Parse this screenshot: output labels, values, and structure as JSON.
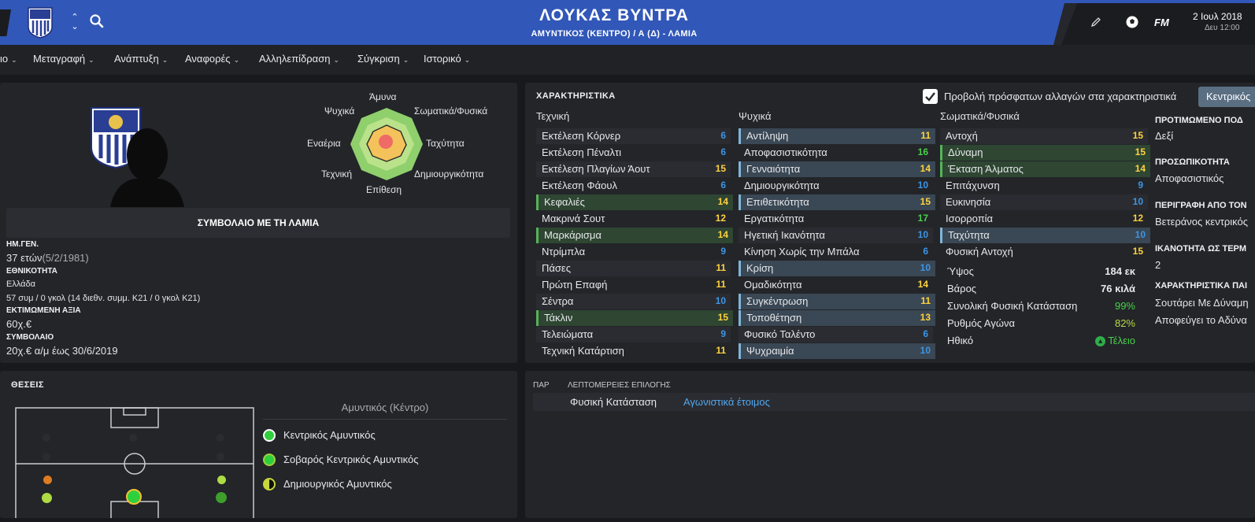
{
  "header": {
    "player_name": "ΛΟΥΚΑΣ ΒΥΝΤΡΑ",
    "subtitle": "ΑΜΥΝΤΙΚΟΣ (ΚΕΝΤΡΟ) / Α (Δ) - ΛΑΜΙΑ",
    "fm_label": "FM",
    "date": "2 Ιουλ 2018",
    "day_time": "Δευ 12:00",
    "icons": [
      "club-badge",
      "nav-up-down",
      "search-icon",
      "pencil-icon",
      "football-icon"
    ]
  },
  "menu": {
    "items": [
      "ιο",
      "Μεταγραφή",
      "Ανάπτυξη",
      "Αναφορές",
      "Αλληλεπίδραση",
      "Σύγκριση",
      "Ιστορικό"
    ]
  },
  "profile": {
    "contract_title": "ΣΥΜΒΟΛΑΙΟ ΜΕ ΤΗ ΛΑΜΙΑ",
    "dob_label": "ΗΜ.ΓΕΝ.",
    "age": "37 ετών",
    "dob": "(5/2/1981)",
    "nationality_label": "ΕΘΝΙΚΟΤΗΤΑ",
    "nationality": "Ελλάδα",
    "caps": "57 συμ / 0 γκολ (14 διεθν. συμμ. Κ21 / 0 γκολ Κ21)",
    "value_label": "ΕΚΤΙΜΩΜΕΝΗ ΑΞΙΑ",
    "value": "60χ.€",
    "contract_label": "ΣΥΜΒΟΛΑΙΟ",
    "contract": "20χ.€ α/μ έως 30/6/2019",
    "radar": {
      "defence": "Άμυνα",
      "physical": "Σωματικά/Φυσικά",
      "speed": "Ταχύτητα",
      "creativity": "Δημιουργικότητα",
      "attack": "Επίθεση",
      "technical": "Τεχνική",
      "aerial": "Εναέρια",
      "mental": "Ψυχικά"
    }
  },
  "attributes": {
    "title": "ΧΑΡΑΚΤΗΡΙΣΤΙΚΑ",
    "checkbox_label": "Προβολή πρόσφατων αλλαγών στα χαρακτηριστικά",
    "role_button": "Κεντρικός",
    "technical_header": "Τεχνική",
    "mental_header": "Ψυχικά",
    "physical_header": "Σωματικά/Φυσικά",
    "technical": [
      {
        "name": "Εκτέλεση Κόρνερ",
        "value": "6"
      },
      {
        "name": "Εκτέλεση Πέναλτι",
        "value": "6"
      },
      {
        "name": "Εκτέλεση Πλαγίων Άουτ",
        "value": "15"
      },
      {
        "name": "Εκτέλεση Φάουλ",
        "value": "6"
      },
      {
        "name": "Κεφαλιές",
        "value": "14"
      },
      {
        "name": "Μακρινά Σουτ",
        "value": "12"
      },
      {
        "name": "Μαρκάρισμα",
        "value": "14"
      },
      {
        "name": "Ντρίμπλα",
        "value": "9"
      },
      {
        "name": "Πάσες",
        "value": "11"
      },
      {
        "name": "Πρώτη Επαφή",
        "value": "11"
      },
      {
        "name": "Σέντρα",
        "value": "10"
      },
      {
        "name": "Τάκλιν",
        "value": "15"
      },
      {
        "name": "Τελειώματα",
        "value": "9"
      },
      {
        "name": "Τεχνική Κατάρτιση",
        "value": "11"
      }
    ],
    "mental": [
      {
        "name": "Αντίληψη",
        "value": "11"
      },
      {
        "name": "Αποφασιστικότητα",
        "value": "16"
      },
      {
        "name": "Γενναιότητα",
        "value": "14"
      },
      {
        "name": "Δημιουργικότητα",
        "value": "10"
      },
      {
        "name": "Επιθετικότητα",
        "value": "15"
      },
      {
        "name": "Εργατικότητα",
        "value": "17"
      },
      {
        "name": "Ηγετική Ικανότητα",
        "value": "10"
      },
      {
        "name": "Κίνηση Χωρίς την Μπάλα",
        "value": "6"
      },
      {
        "name": "Κρίση",
        "value": "10"
      },
      {
        "name": "Ομαδικότητα",
        "value": "14"
      },
      {
        "name": "Συγκέντρωση",
        "value": "11"
      },
      {
        "name": "Τοποθέτηση",
        "value": "13"
      },
      {
        "name": "Φυσικό Ταλέντο",
        "value": "6"
      },
      {
        "name": "Ψυχραιμία",
        "value": "10"
      }
    ],
    "physical": [
      {
        "name": "Αντοχή",
        "value": "15"
      },
      {
        "name": "Δύναμη",
        "value": "15"
      },
      {
        "name": "Έκταση Άλματος",
        "value": "14"
      },
      {
        "name": "Επιτάχυνση",
        "value": "9"
      },
      {
        "name": "Ευκινησία",
        "value": "10"
      },
      {
        "name": "Ισορροπία",
        "value": "12"
      },
      {
        "name": "Ταχύτητα",
        "value": "10"
      },
      {
        "name": "Φυσική Αντοχή",
        "value": "15"
      }
    ],
    "stats": [
      {
        "name": "Ύψος",
        "value": "184 εκ"
      },
      {
        "name": "Βάρος",
        "value": "76 κιλά"
      },
      {
        "name": "Συνολική Φυσική Κατάσταση",
        "value": "99%"
      },
      {
        "name": "Ρυθμός Αγώνα",
        "value": "82%"
      },
      {
        "name": "Ηθικό",
        "value": "Τέλειο"
      }
    ]
  },
  "side_info": {
    "foot_label": "ΠΡΟΤΙΜΩΜΕΝΟ ΠΟΔ",
    "foot": "Δεξί",
    "personality_label": "ΠΡΟΣΩΠΙΚΟΤΗΤΑ",
    "personality": "Αποφασιστικός",
    "description_label": "ΠΕΡΙΓΡΑΦΗ ΑΠΟ ΤΟΝ",
    "description": "Βετεράνος κεντρικός",
    "ability_label": "ΙΚΑΝΟΤΗΤΑ ΩΣ ΤΕΡΜ",
    "ability": "2",
    "traits_label": "ΧΑΡΑΚΤΗΡΙΣΤΙΚΑ ΠΑΙ",
    "traits": [
      "Σουτάρει Με Δύναμη",
      "Αποφεύγει το Αδύνα"
    ]
  },
  "positions": {
    "title": "ΘΕΣΕΙΣ",
    "current": "Αμυντικός (Κέντρο)",
    "roles": [
      "Κεντρικός Αμυντικός",
      "Σοβαρός Κεντρικός Αμυντικός",
      "Δημιουργικός Αμυντικός"
    ]
  },
  "selection": {
    "col1": "ΠΑΡ",
    "col2": "ΛΕΠΤΟΜΕΡΕΙΕΣ ΕΠΙΛΟΓΗΣ",
    "condition_label": "Φυσική Κατάσταση",
    "condition_value": "Αγωνιστικά έτοιμος"
  },
  "colors": {
    "header_blue": "#3157b8",
    "attr_blue": "#3c95e6",
    "attr_yellow": "#ffd23c",
    "attr_green": "#49d04b",
    "highlight_green": "#2e4632",
    "highlight_blue": "#3a4754"
  }
}
